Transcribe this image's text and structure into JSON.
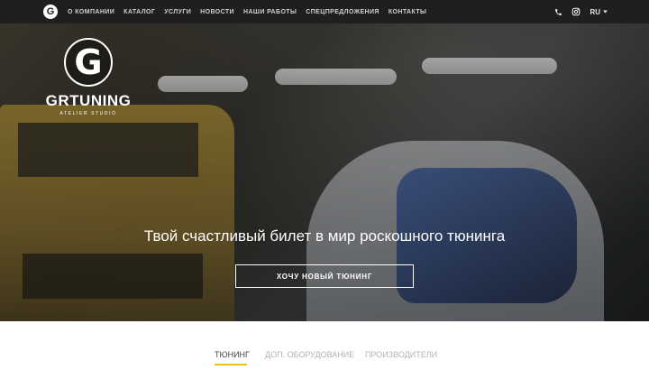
{
  "header": {
    "logo_letter": "G",
    "nav": [
      {
        "label": "О КОМПАНИИ"
      },
      {
        "label": "КАТАЛОГ"
      },
      {
        "label": "УСЛУГИ"
      },
      {
        "label": "НОВОСТИ"
      },
      {
        "label": "НАШИ РАБОТЫ"
      },
      {
        "label": "СПЕЦПРЕДЛОЖЕНИЯ"
      },
      {
        "label": "КОНТАКТЫ"
      }
    ],
    "icons": {
      "phone": "phone-icon",
      "instagram": "instagram-icon",
      "dropdown": "chevron-down-icon"
    },
    "language": "RU"
  },
  "hero": {
    "brand_name": "GRTUNING",
    "brand_subtitle": "ATELIER STUDIO",
    "brand_letter": "G",
    "title": "Твой счастливый билет в мир роскошного тюнинга",
    "cta_label": "ХОЧУ НОВЫЙ ТЮНИНГ"
  },
  "tabs": [
    {
      "label": "ТЮНИНГ",
      "active": true
    },
    {
      "label": "ДОП. ОБОРУДОВАНИЕ",
      "active": false
    },
    {
      "label": "ПРОИЗВОДИТЕЛИ",
      "active": false
    }
  ],
  "colors": {
    "accent": "#e8c21b",
    "topbar": "#1f1f1f"
  }
}
